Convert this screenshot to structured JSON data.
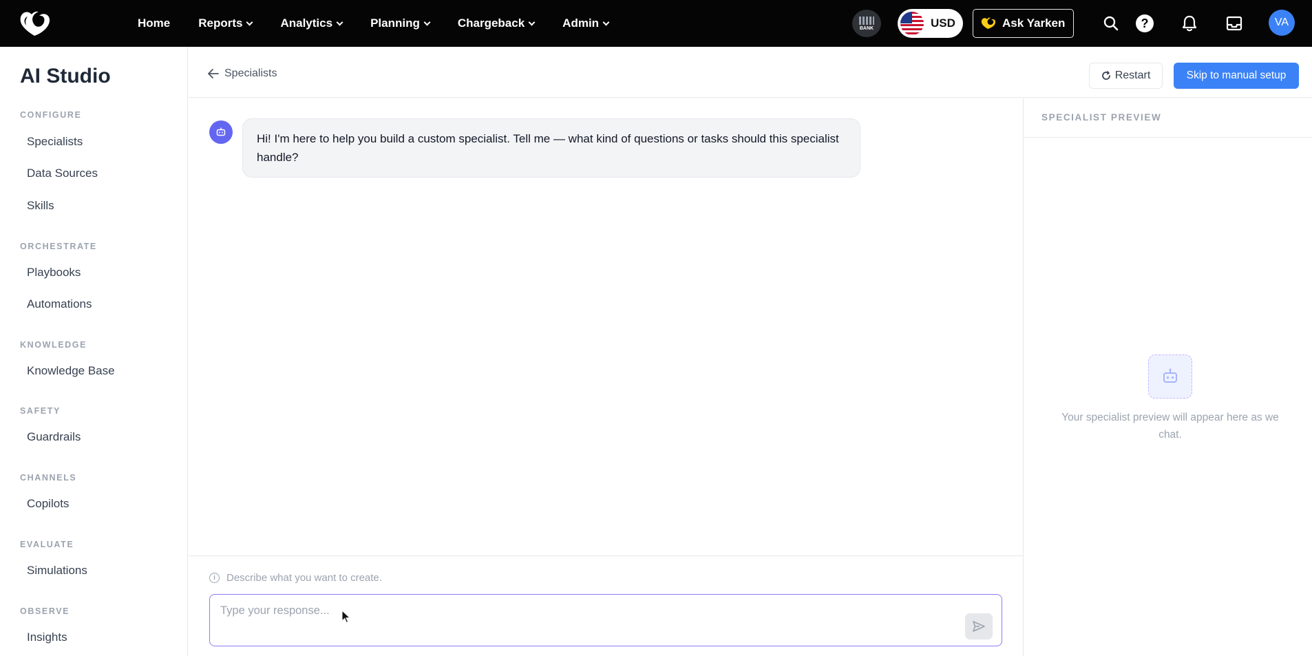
{
  "topnav": {
    "items": [
      {
        "label": "Home",
        "has_menu": false
      },
      {
        "label": "Reports",
        "has_menu": true
      },
      {
        "label": "Analytics",
        "has_menu": true
      },
      {
        "label": "Planning",
        "has_menu": true
      },
      {
        "label": "Chargeback",
        "has_menu": true
      },
      {
        "label": "Admin",
        "has_menu": true
      }
    ],
    "bank_label": "BANK",
    "currency": "USD",
    "ask_label": "Ask Yarken",
    "avatar_initials": "VA",
    "icons": [
      "search-icon",
      "help-icon",
      "bell-icon",
      "inbox-icon"
    ]
  },
  "sidebar": {
    "title": "AI Studio",
    "sections": [
      {
        "label": "CONFIGURE",
        "items": [
          "Specialists",
          "Data Sources",
          "Skills"
        ]
      },
      {
        "label": "ORCHESTRATE",
        "items": [
          "Playbooks",
          "Automations"
        ]
      },
      {
        "label": "KNOWLEDGE",
        "items": [
          "Knowledge Base"
        ]
      },
      {
        "label": "SAFETY",
        "items": [
          "Guardrails"
        ]
      },
      {
        "label": "CHANNELS",
        "items": [
          "Copilots"
        ]
      },
      {
        "label": "EVALUATE",
        "items": [
          "Simulations"
        ]
      },
      {
        "label": "OBSERVE",
        "items": [
          "Insights"
        ]
      }
    ]
  },
  "header": {
    "back_label": "Specialists",
    "restart_label": "Restart",
    "skip_label": "Skip to manual setup"
  },
  "chat": {
    "messages": [
      {
        "role": "assistant",
        "text": "Hi! I'm here to help you build a custom specialist. Tell me — what kind of questions or tasks should this specialist handle?"
      }
    ],
    "hint": "Describe what you want to create.",
    "input_placeholder": "Type your response...",
    "input_value": ""
  },
  "preview": {
    "title": "SPECIALIST PREVIEW",
    "empty_message": "Your specialist preview will appear here as we chat."
  },
  "colors": {
    "topbar_bg": "#050505",
    "accent": "#3b82f6",
    "bot_avatar": "#6366f1",
    "input_border": "#8b7cf6"
  }
}
